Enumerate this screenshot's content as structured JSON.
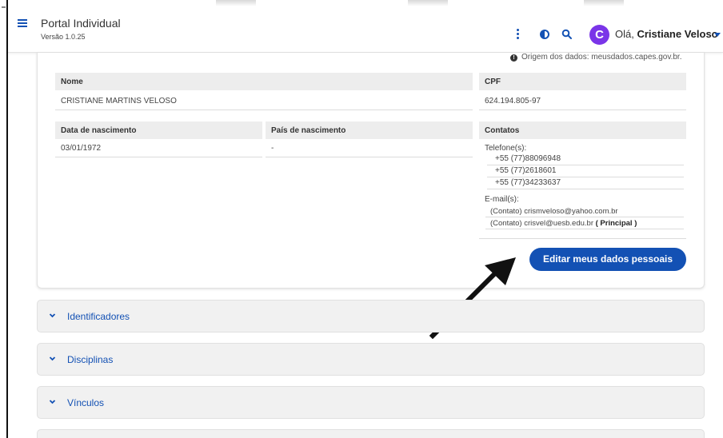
{
  "header": {
    "title": "Portal Individual",
    "version": "Versão 1.0.25",
    "avatar_letter": "C",
    "greeting_prefix": "Olá, ",
    "user_name": "Cristiane Veloso",
    "accent_color": "#1351b4",
    "avatar_color": "#7a35e8"
  },
  "origin_note": "Origem dos dados: meusdados.capes.gov.br.",
  "personal": {
    "nome_label": "Nome",
    "nome_value": "CRISTIANE MARTINS VELOSO",
    "cpf_label": "CPF",
    "cpf_value": "624.194.805-97",
    "nascimento_label": "Data de nascimento",
    "nascimento_value": "03/01/1972",
    "pais_label": "País de nascimento",
    "pais_value": "-",
    "contatos_label": "Contatos",
    "telefones_label": "Telefone(s):",
    "telefones": [
      "+55 (77)88096948",
      "+55 (77)2618601",
      "+55 (77)34233637"
    ],
    "emails_label": "E-mail(s):",
    "emails": [
      {
        "text": "(Contato) crismveloso@yahoo.com.br",
        "tag": ""
      },
      {
        "text": "(Contato) crisvel@uesb.edu.br",
        "tag": "( Principal )"
      }
    ]
  },
  "edit_button": "Editar meus dados pessoais",
  "accordions": [
    {
      "label": "Identificadores",
      "icon": "chevron-down-icon"
    },
    {
      "label": "Disciplinas",
      "icon": "chevron-down-icon"
    },
    {
      "label": "Vínculos",
      "icon": "chevron-down-icon"
    }
  ]
}
